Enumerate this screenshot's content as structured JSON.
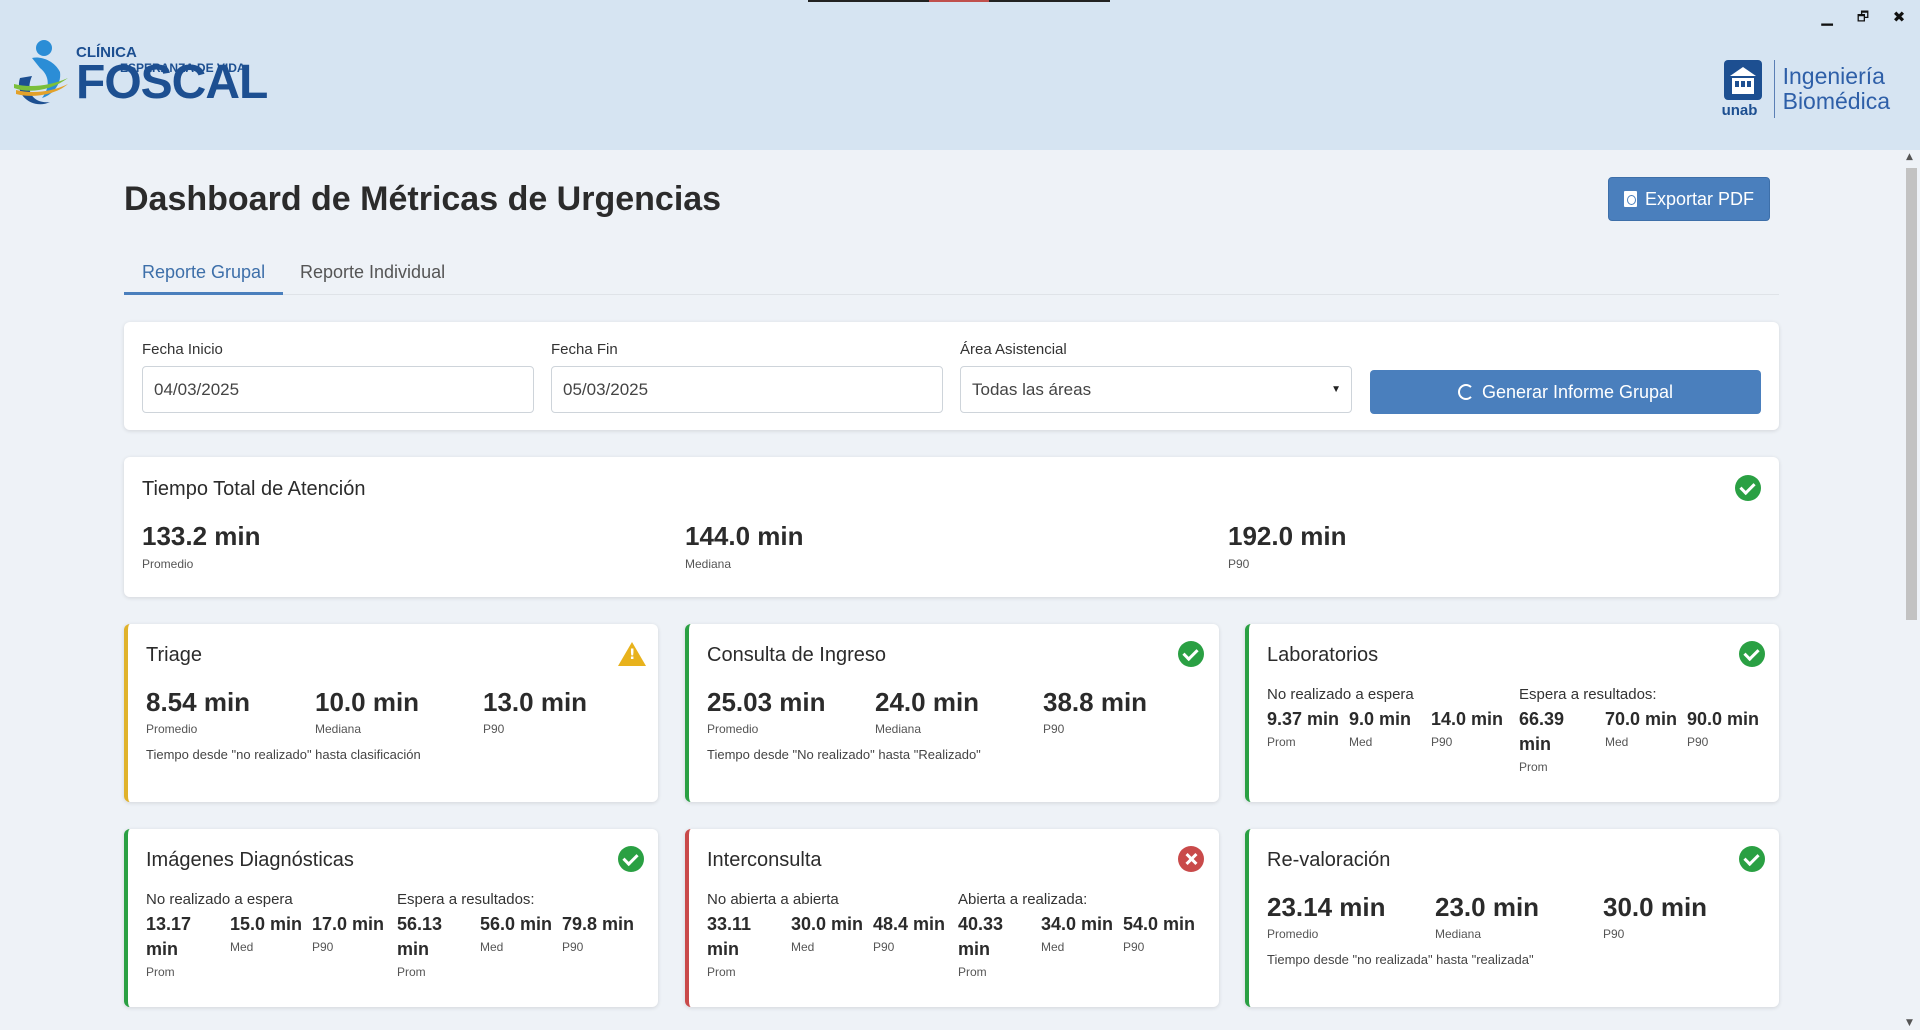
{
  "window": {
    "minimize": "▁",
    "restore": "🗗",
    "close": "✖"
  },
  "header": {
    "logo_left": {
      "line1": "CLÍNICA",
      "line2": "FOSCAL",
      "tagline": "ESPERANZA DE VIDA"
    },
    "logo_right": {
      "unab": "unab",
      "line1": "Ingeniería",
      "line2": "Biomédica"
    }
  },
  "page": {
    "title": "Dashboard de Métricas de Urgencias",
    "export_label": "Exportar PDF"
  },
  "tabs": [
    {
      "label": "Reporte Grupal",
      "active": true
    },
    {
      "label": "Reporte Individual",
      "active": false
    }
  ],
  "filters": {
    "start_label": "Fecha Inicio",
    "start_value": "04/03/2025",
    "end_label": "Fecha Fin",
    "end_value": "05/03/2025",
    "area_label": "Área Asistencial",
    "area_value": "Todas las áreas",
    "generate_label": "Generar Informe Grupal"
  },
  "total": {
    "title": "Tiempo Total de Atención",
    "status": "ok",
    "avg": "133.2 min",
    "avg_label": "Promedio",
    "median": "144.0 min",
    "median_label": "Mediana",
    "p90": "192.0 min",
    "p90_label": "P90"
  },
  "triage": {
    "title": "Triage",
    "status": "warning",
    "avg": "8.54 min",
    "avg_label": "Promedio",
    "median": "10.0 min",
    "median_label": "Mediana",
    "p90": "13.0 min",
    "p90_label": "P90",
    "desc": "Tiempo desde \"no realizado\" hasta clasificación"
  },
  "consulta": {
    "title": "Consulta de Ingreso",
    "status": "ok",
    "avg": "25.03 min",
    "avg_label": "Promedio",
    "median": "24.0 min",
    "median_label": "Mediana",
    "p90": "38.8 min",
    "p90_label": "P90",
    "desc": "Tiempo desde \"No realizado\" hasta \"Realizado\""
  },
  "laboratorios": {
    "title": "Laboratorios",
    "status": "ok",
    "g1_title": "No realizado a espera",
    "g1_prom": "9.37 min",
    "g1_med": "9.0 min",
    "g1_p90": "14.0 min",
    "g2_title": "Espera a resultados:",
    "g2_prom_a": "66.39",
    "g2_prom_b": "min",
    "g2_med": "70.0 min",
    "g2_p90": "90.0 min",
    "prom": "Prom",
    "med": "Med",
    "p90": "P90"
  },
  "imagenes": {
    "title": "Imágenes Diagnósticas",
    "status": "ok",
    "g1_title": "No realizado a espera",
    "g1_prom_a": "13.17",
    "g1_prom_b": "min",
    "g1_med": "15.0 min",
    "g1_p90": "17.0 min",
    "g2_title": "Espera a resultados:",
    "g2_prom_a": "56.13",
    "g2_prom_b": "min",
    "g2_med": "56.0 min",
    "g2_p90": "79.8 min",
    "prom": "Prom",
    "med": "Med",
    "p90": "P90"
  },
  "interconsulta": {
    "title": "Interconsulta",
    "status": "error",
    "g1_title": "No abierta a abierta",
    "g1_prom_a": "33.11",
    "g1_prom_b": "min",
    "g1_med": "30.0 min",
    "g1_p90": "48.4 min",
    "g2_title": "Abierta a realizada:",
    "g2_prom_a": "40.33",
    "g2_prom_b": "min",
    "g2_med": "34.0 min",
    "g2_p90": "54.0 min",
    "prom": "Prom",
    "med": "Med",
    "p90": "P90"
  },
  "revaloracion": {
    "title": "Re-valoración",
    "status": "ok",
    "avg": "23.14 min",
    "avg_label": "Promedio",
    "median": "23.0 min",
    "median_label": "Mediana",
    "p90": "30.0 min",
    "p90_label": "P90",
    "desc": "Tiempo desde \"no realizada\" hasta \"realizada\""
  },
  "colors": {
    "accent": "#4a7fbd",
    "ok": "#2aa043",
    "warning": "#e0b22b",
    "error": "#c94a4a",
    "header_bg": "#d6e4f2"
  }
}
